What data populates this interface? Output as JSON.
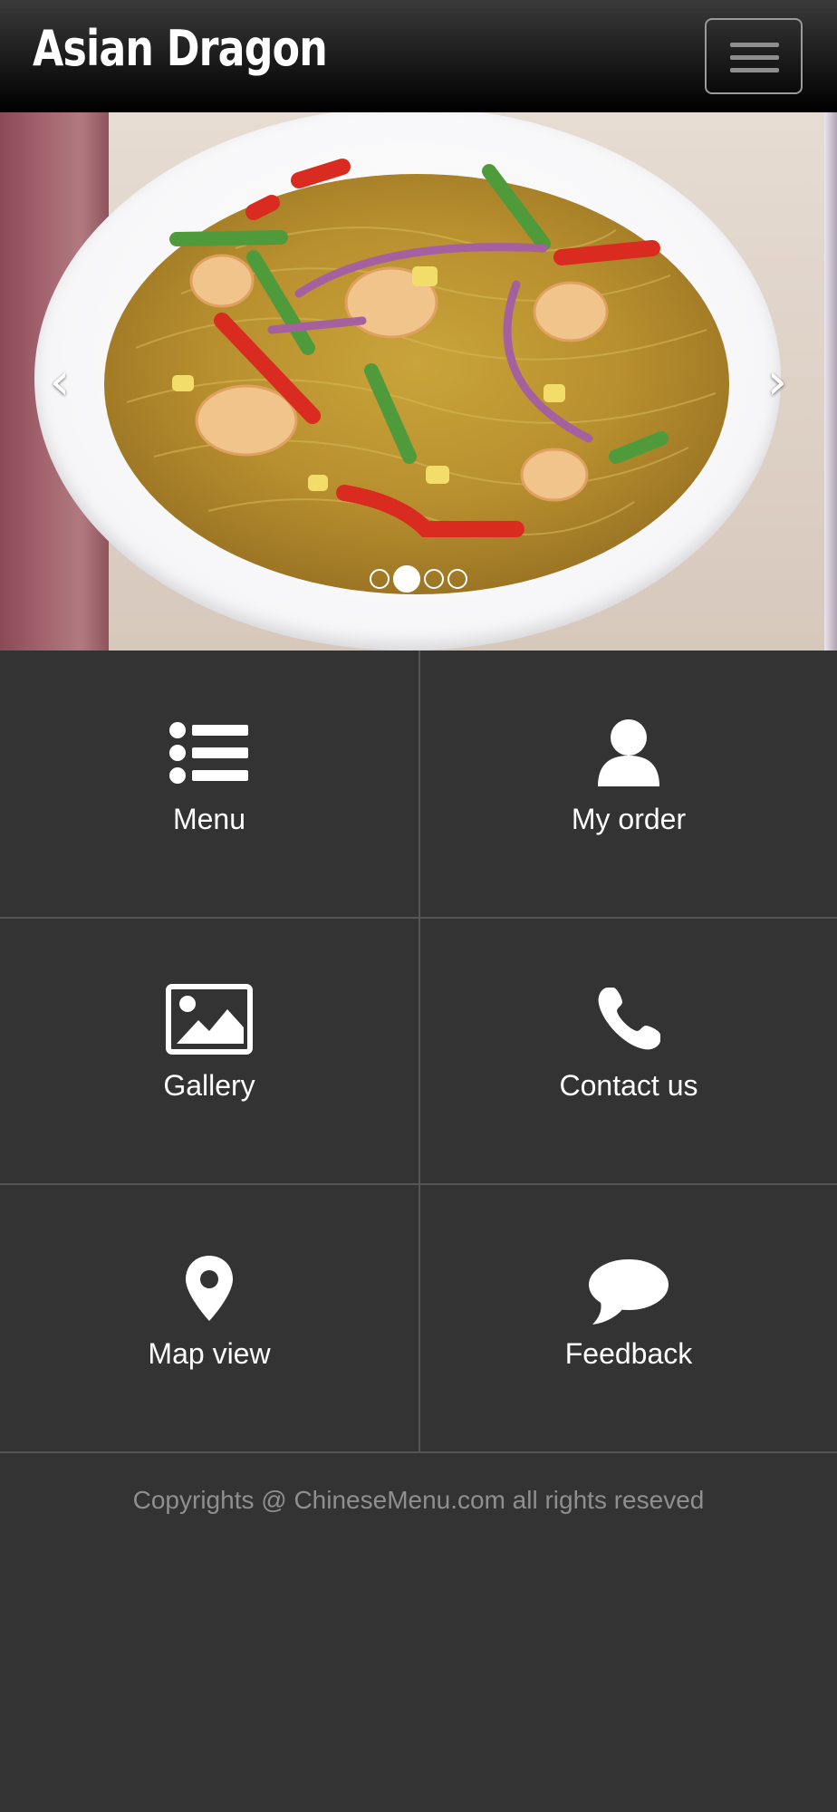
{
  "header": {
    "brand": "Asian Dragon",
    "menu_toggle_icon": "hamburger-icon"
  },
  "carousel": {
    "image": "noodle-dish-photo",
    "prev_icon": "chevron-left-icon",
    "next_icon": "chevron-right-icon",
    "prev_glyph": "‹",
    "next_glyph": "›",
    "slide_count": 4,
    "active_slide": 2
  },
  "tiles": [
    {
      "label": "Menu",
      "icon": "list-icon"
    },
    {
      "label": "My order",
      "icon": "user-icon"
    },
    {
      "label": "Gallery",
      "icon": "image-icon"
    },
    {
      "label": "Contact us",
      "icon": "phone-icon"
    },
    {
      "label": "Map view",
      "icon": "map-pin-icon"
    },
    {
      "label": "Feedback",
      "icon": "chat-bubble-icon"
    }
  ],
  "footer": {
    "copyright": "Copyrights @ ChineseMenu.com all rights reseved"
  },
  "colors": {
    "background": "#333333",
    "header_dark": "#000000",
    "tile_border": "#555555",
    "footer_text": "#8f8f8f"
  }
}
